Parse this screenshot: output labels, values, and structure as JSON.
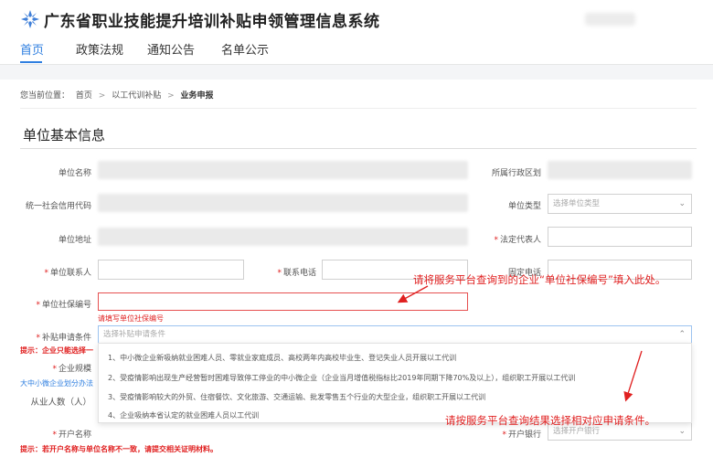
{
  "header": {
    "title": "广东省职业技能提升培训补贴申领管理信息系统",
    "nav": [
      "首页",
      "政策法规",
      "通知公告",
      "名单公示"
    ]
  },
  "breadcrumb": {
    "prefix": "您当前位置：",
    "items": [
      "首页",
      "以工代训补贴",
      "业务申报"
    ],
    "sep": ">"
  },
  "section_title": "单位基本信息",
  "form": {
    "unit_name": "单位名称",
    "region": "所属行政区划",
    "credit_code": "统一社会信用代码",
    "unit_type": "单位类型",
    "unit_type_placeholder": "选择单位类型",
    "address": "单位地址",
    "legal_rep": "法定代表人",
    "contact": "单位联系人",
    "phone": "联系电话",
    "fixed_phone": "固定电话",
    "social_no": "单位社保编号",
    "social_no_error": "请填写单位社保编号",
    "condition": "补贴申请条件",
    "condition_placeholder": "选择补贴申请条件",
    "tip1": "提示：企业只能选择一",
    "scale": "企业规模",
    "scale_link": "大中小微企业划分办法",
    "employees": "从业人数（人）",
    "account_name": "开户名称",
    "bank": "开户银行",
    "bank_placeholder": "选择开户银行",
    "tip2": "提示：若开户名称与单位名称不一致，请提交相关证明材料。"
  },
  "dropdown_options": [
    "1、中小微企业新吸纳就业困难人员、零就业家庭成员、高校两年内高校毕业生、登记失业人员开展以工代训",
    "2、受疫情影响出现生产经营暂时困难导致停工停业的中小微企业（企业当月增值税指标比2019年同期下降70%及以上），组织职工开展以工代训",
    "3、受疫情影响较大的外贸、住宿餐饮、文化旅游、交通运输、批发零售五个行业的大型企业，组织职工开展以工代训",
    "4、企业吸纳本省认定的就业困难人员以工代训"
  ],
  "annotations": {
    "top": "请将服务平台查询到的企业“单位社保编号”填入此处。",
    "bottom": "请按服务平台查询结果选择相对应申请条件。"
  },
  "colors": {
    "accent": "#2f7fe0",
    "error": "#e02020"
  }
}
